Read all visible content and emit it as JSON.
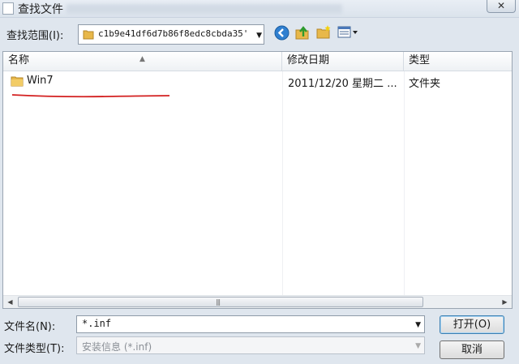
{
  "window": {
    "title": "查找文件",
    "close_label": "✕"
  },
  "look_in": {
    "label": "查找范围(I):",
    "path": "c1b9e41df6d7b86f8edc8cbda35'"
  },
  "columns": [
    {
      "label": "名称"
    },
    {
      "label": "修改日期"
    },
    {
      "label": "类型"
    }
  ],
  "files": [
    {
      "name": "Win7",
      "modified": "2011/12/20 星期二 ...",
      "type": "文件夹"
    }
  ],
  "filename": {
    "label": "文件名(N):",
    "value": "*.inf"
  },
  "filetype": {
    "label": "文件类型(T):",
    "value": "安装信息 (*.inf)"
  },
  "buttons": {
    "open": "打开(O)",
    "cancel": "取消"
  },
  "icons": [
    "folder-icon",
    "back-icon",
    "up-folder-icon",
    "new-folder-icon",
    "view-menu-icon",
    "close-icon",
    "dropdown-arrow-icon"
  ],
  "colors": {
    "annotation_underline": "#d32020",
    "folder": "#e8b84a",
    "back_button": "#2f7fd0"
  }
}
